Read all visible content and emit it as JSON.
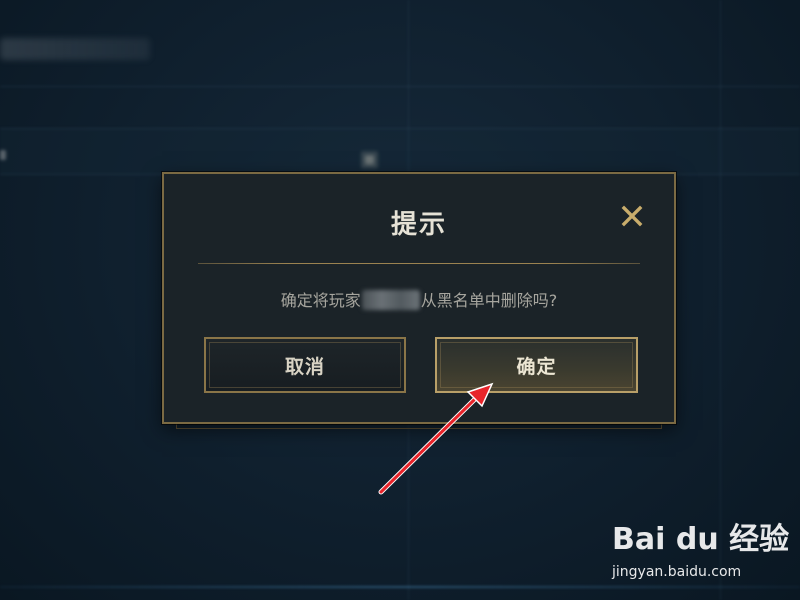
{
  "dialog": {
    "title": "提示",
    "message_before": "确定将玩家",
    "message_after": "从黑名单中删除吗?",
    "cancel_label": "取消",
    "confirm_label": "确定"
  },
  "icons": {
    "close": "close-icon"
  },
  "colors": {
    "accent_gold": "#b89f68",
    "dialog_bg": "#1b2328",
    "arrow_red": "#e8242a"
  },
  "watermark": {
    "logo_text": "Bai du 经验",
    "url": "jingyan.baidu.com"
  }
}
